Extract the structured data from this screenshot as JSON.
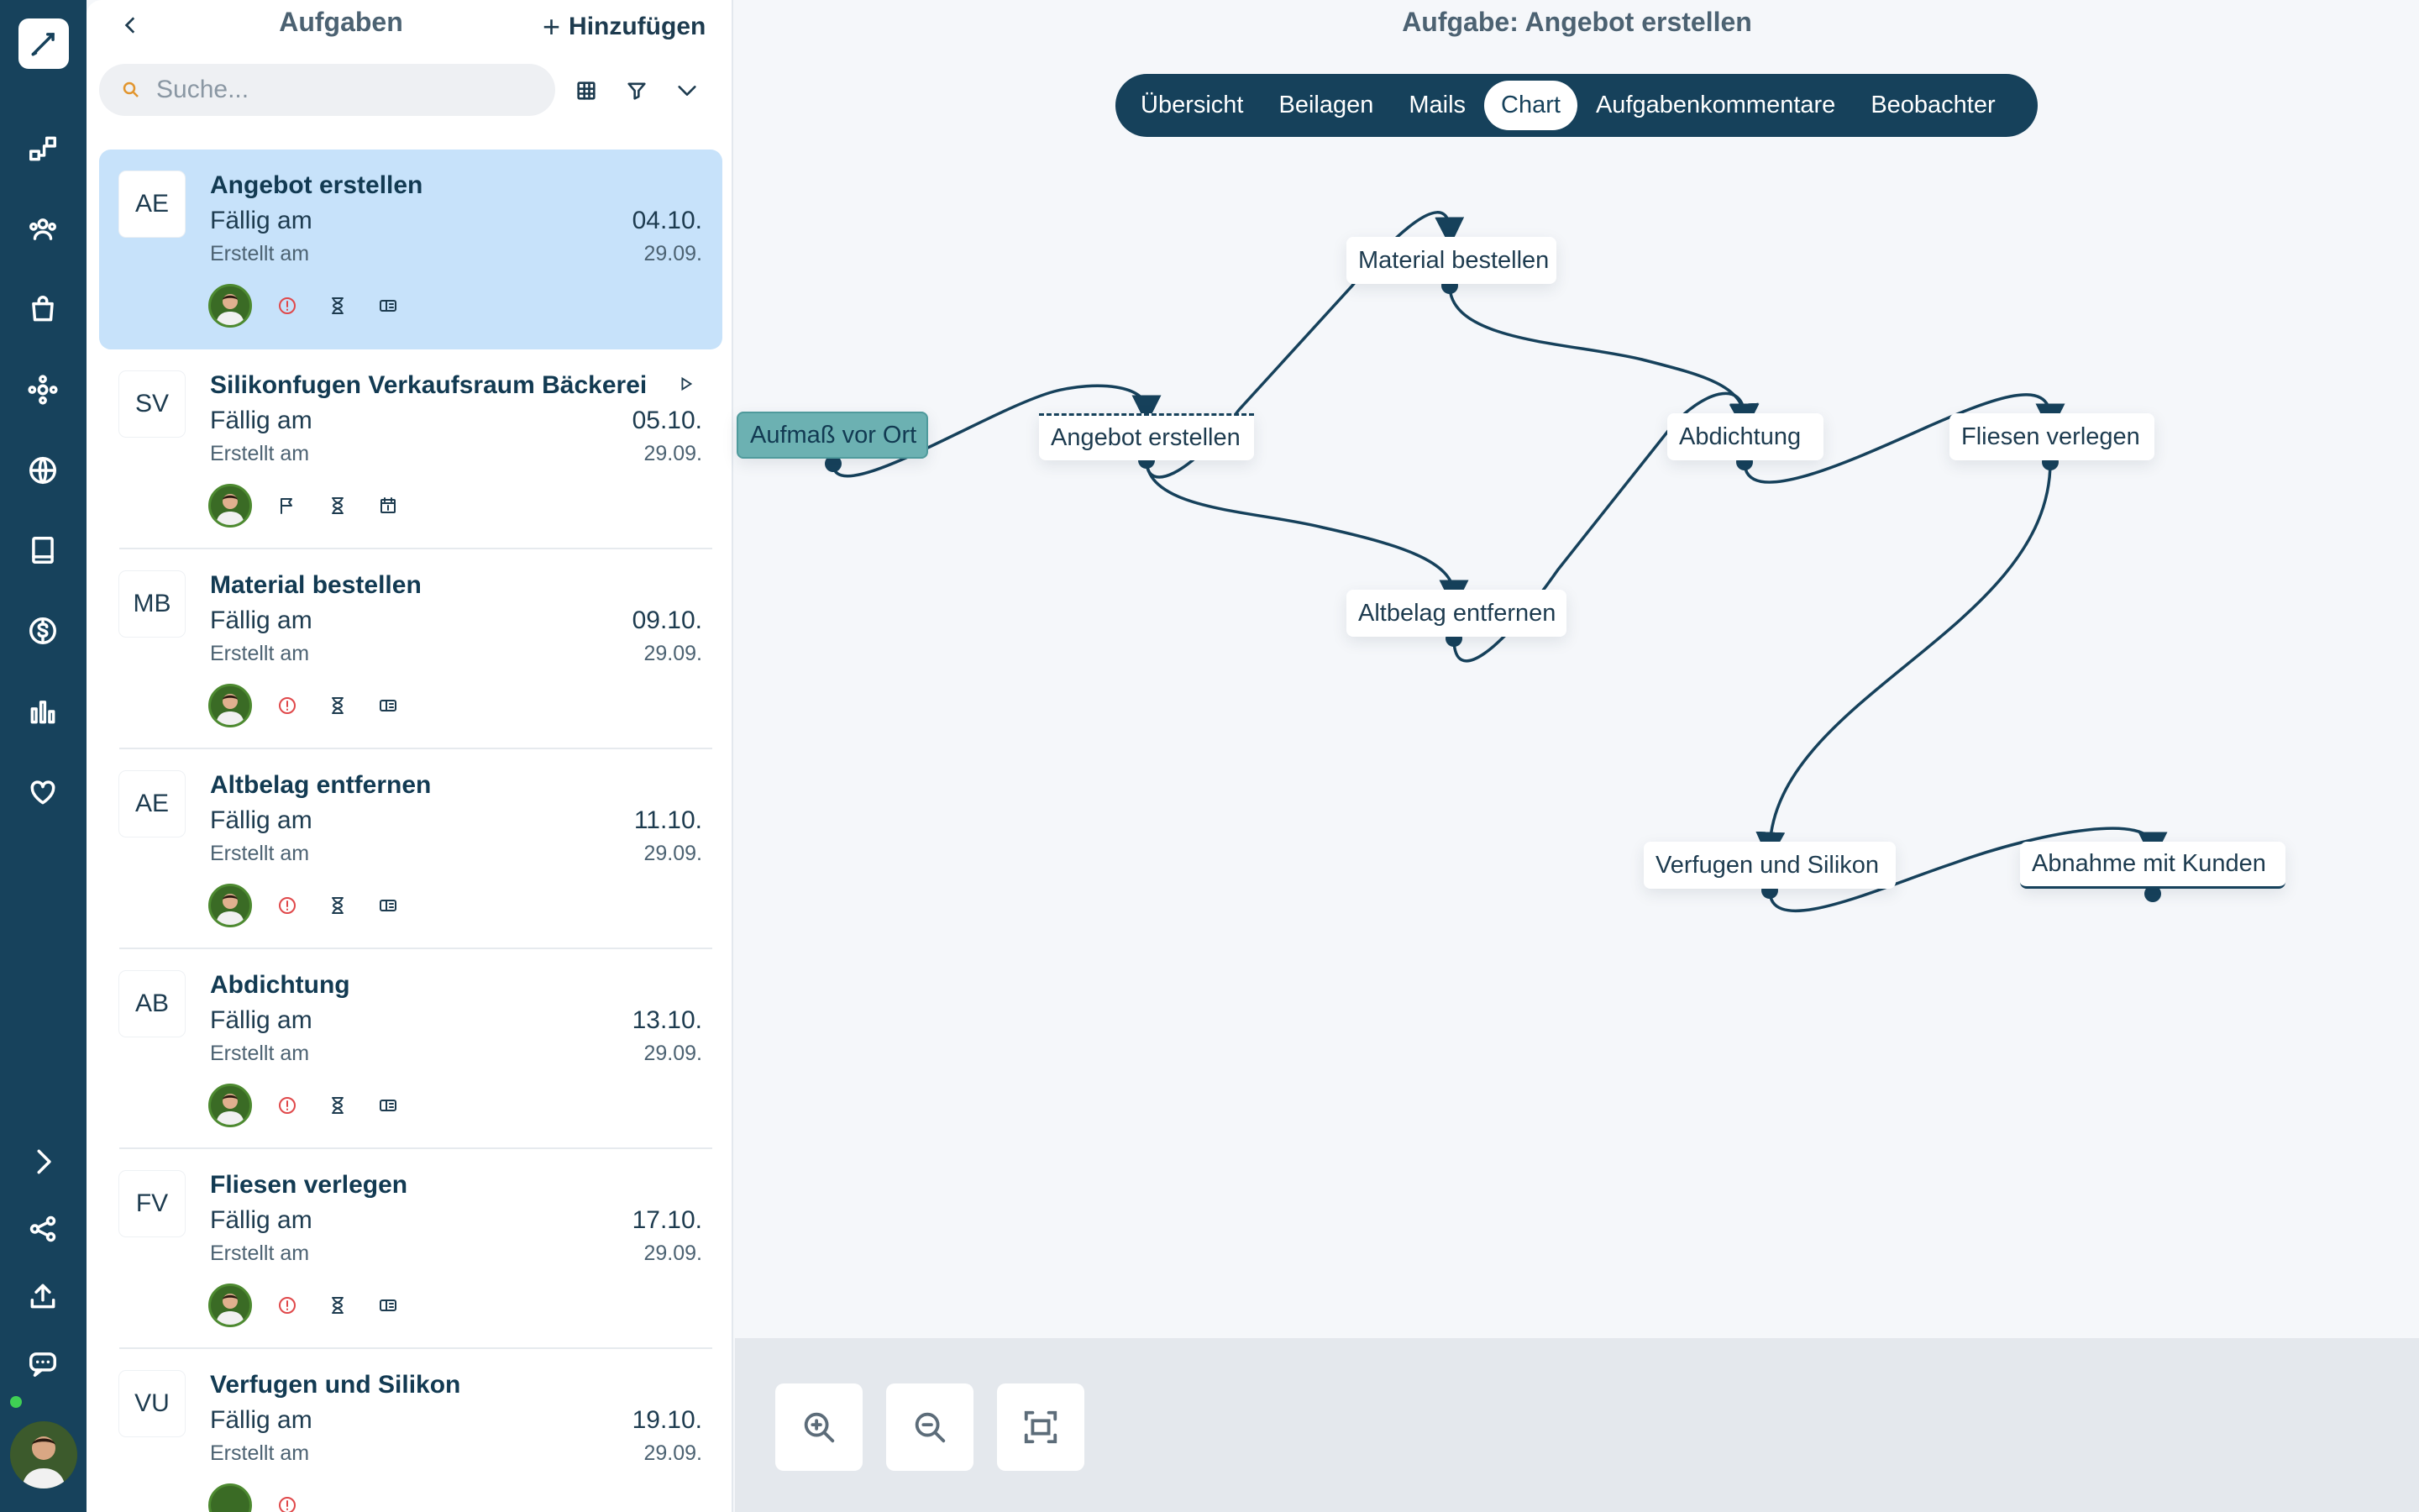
{
  "rail": {
    "icons": [
      "brush-icon",
      "workflow-icon",
      "team-icon",
      "bag-icon",
      "network-icon",
      "globe-icon",
      "book-icon",
      "dollar-icon",
      "bar-chart-icon",
      "heart-icon",
      "chevron-right-icon",
      "share-icon",
      "upload-icon",
      "chat-icon"
    ]
  },
  "panel": {
    "title": "Aufgaben",
    "add_label": "Hinzufügen",
    "search_placeholder": "Suche...",
    "tasks": [
      {
        "initials": "AE",
        "title": "Angebot erstellen",
        "due_label": "Fällig am",
        "due_date": "04.10.",
        "created_label": "Erstellt am",
        "created_date": "29.09."
      },
      {
        "initials": "SV",
        "title": "Silikonfugen Verkaufsraum Bäckerei",
        "due_label": "Fällig am",
        "due_date": "05.10.",
        "created_label": "Erstellt am",
        "created_date": "29.09."
      },
      {
        "initials": "MB",
        "title": "Material bestellen",
        "due_label": "Fällig am",
        "due_date": "09.10.",
        "created_label": "Erstellt am",
        "created_date": "29.09."
      },
      {
        "initials": "AE",
        "title": "Altbelag entfernen",
        "due_label": "Fällig am",
        "due_date": "11.10.",
        "created_label": "Erstellt am",
        "created_date": "29.09."
      },
      {
        "initials": "AB",
        "title": "Abdichtung",
        "due_label": "Fällig am",
        "due_date": "13.10.",
        "created_label": "Erstellt am",
        "created_date": "29.09."
      },
      {
        "initials": "FV",
        "title": "Fliesen verlegen",
        "due_label": "Fällig am",
        "due_date": "17.10.",
        "created_label": "Erstellt am",
        "created_date": "29.09."
      },
      {
        "initials": "VU",
        "title": "Verfugen und Silikon",
        "due_label": "Fällig am",
        "due_date": "19.10.",
        "created_label": "Erstellt am",
        "created_date": "29.09."
      }
    ]
  },
  "main": {
    "title": "Aufgabe: Angebot erstellen",
    "tabs": [
      "Übersicht",
      "Beilagen",
      "Mails",
      "Chart",
      "Aufgabenkommentare",
      "Beobachter"
    ],
    "active_tab": "Chart",
    "nodes": {
      "aufmass": "Aufmaß vor Ort",
      "angebot": "Angebot erstellen",
      "material": "Material bestellen",
      "altbelag": "Altbelag entfernen",
      "abdichtung": "Abdichtung",
      "fliesen": "Fliesen verlegen",
      "verfugen": "Verfugen und Silikon",
      "abnahme": "Abnahme mit Kunden"
    }
  },
  "colors": {
    "rail": "#17425c",
    "accent": "#16415b",
    "selected_row": "#c7e2fa",
    "highlight_node": "#6cb1b2",
    "warning": "#e0484a"
  }
}
